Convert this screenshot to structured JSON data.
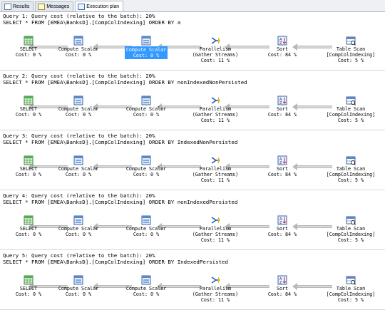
{
  "tabs": [
    {
      "label": "Results",
      "icon": "grid-icon",
      "active": false
    },
    {
      "label": "Messages",
      "icon": "messages-icon",
      "active": false
    },
    {
      "label": "Execution plan",
      "icon": "execution-plan-icon",
      "active": true
    }
  ],
  "queries": [
    {
      "header": "Query 1: Query cost (relative to the batch): 20%",
      "sql": "SELECT * FROM [EMEA\\BanksD].[CompColIndexing] ORDER BY a",
      "select": {
        "name": "SELECT",
        "cost": "Cost: 0 %"
      },
      "compute1": {
        "name": "Compute Scalar",
        "cost": "Cost: 0 %"
      },
      "compute2": {
        "name": "Compute Scalar",
        "cost": "Cost: 0 %",
        "selected": true
      },
      "parallel": {
        "name": "Parallelism",
        "sub": "(Gather Streams)",
        "cost": "Cost: 11 %"
      },
      "sort": {
        "name": "Sort",
        "cost": "Cost: 84 %"
      },
      "scan": {
        "name": "Table Scan",
        "sub": "[CompColIndexing]",
        "cost": "Cost: 5 %"
      }
    },
    {
      "header": "Query 2: Query cost (relative to the batch): 20%",
      "sql": "SELECT * FROM [EMEA\\BanksD].[CompColIndexing] ORDER BY nonIndexedNonPersisted",
      "select": {
        "name": "SELECT",
        "cost": "Cost: 0 %"
      },
      "compute1": {
        "name": "Compute Scalar",
        "cost": "Cost: 0 %"
      },
      "compute2": {
        "name": "Compute Scalar",
        "cost": "Cost: 0 %",
        "selected": false
      },
      "parallel": {
        "name": "Parallelism",
        "sub": "(Gather Streams)",
        "cost": "Cost: 11 %"
      },
      "sort": {
        "name": "Sort",
        "cost": "Cost: 84 %"
      },
      "scan": {
        "name": "Table Scan",
        "sub": "[CompColIndexing]",
        "cost": "Cost: 5 %"
      }
    },
    {
      "header": "Query 3: Query cost (relative to the batch): 20%",
      "sql": "SELECT * FROM [EMEA\\BanksD].[CompColIndexing] ORDER BY IndexedNonPersisted",
      "select": {
        "name": "SELECT",
        "cost": "Cost: 0 %"
      },
      "compute1": {
        "name": "Compute Scalar",
        "cost": "Cost: 0 %"
      },
      "compute2": {
        "name": "Compute Scalar",
        "cost": "Cost: 0 %",
        "selected": false
      },
      "parallel": {
        "name": "Parallelism",
        "sub": "(Gather Streams)",
        "cost": "Cost: 11 %"
      },
      "sort": {
        "name": "Sort",
        "cost": "Cost: 84 %"
      },
      "scan": {
        "name": "Table Scan",
        "sub": "[CompColIndexing]",
        "cost": "Cost: 5 %"
      }
    },
    {
      "header": "Query 4: Query cost (relative to the batch): 20%",
      "sql": "SELECT * FROM [EMEA\\BanksD].[CompColIndexing] ORDER BY nonIndexedPersisted",
      "select": {
        "name": "SELECT",
        "cost": "Cost: 0 %"
      },
      "compute1": {
        "name": "Compute Scalar",
        "cost": "Cost: 0 %"
      },
      "compute2": {
        "name": "Compute Scalar",
        "cost": "Cost: 0 %",
        "selected": false
      },
      "parallel": {
        "name": "Parallelism",
        "sub": "(Gather Streams)",
        "cost": "Cost: 11 %"
      },
      "sort": {
        "name": "Sort",
        "cost": "Cost: 84 %"
      },
      "scan": {
        "name": "Table Scan",
        "sub": "[CompColIndexing]",
        "cost": "Cost: 5 %"
      }
    },
    {
      "header": "Query 5: Query cost (relative to the batch): 20%",
      "sql": "SELECT * FROM [EMEA\\BanksD].[CompColIndexing] ORDER BY IndexedPersisted",
      "select": {
        "name": "SELECT",
        "cost": "Cost: 0 %"
      },
      "compute1": {
        "name": "Compute Scalar",
        "cost": "Cost: 0 %"
      },
      "compute2": {
        "name": "Compute Scalar",
        "cost": "Cost: 0 %",
        "selected": false
      },
      "parallel": {
        "name": "Parallelism",
        "sub": "(Gather Streams)",
        "cost": "Cost: 11 %"
      },
      "sort": {
        "name": "Sort",
        "cost": "Cost: 84 %"
      },
      "scan": {
        "name": "Table Scan",
        "sub": "[CompColIndexing]",
        "cost": "Cost: 5 %"
      }
    }
  ]
}
